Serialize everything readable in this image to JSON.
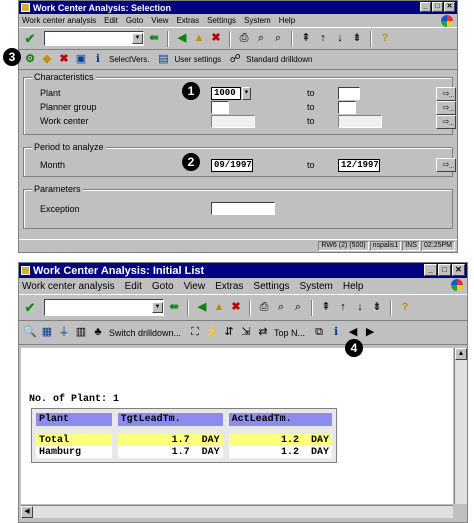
{
  "window1": {
    "title": "Work Center Analysis: Selection",
    "menu": [
      "Work center analysis",
      "Edit",
      "Goto",
      "View",
      "Extras",
      "Settings",
      "System",
      "Help"
    ],
    "app_toolbar": {
      "selectvers_label": "SelectVers.",
      "user_settings_label": "User settings",
      "standard_drilldown_label": "Standard drilldown"
    },
    "characteristics": {
      "title": "Characteristics",
      "plant_label": "Plant",
      "plant_value": "1000",
      "planner_group_label": "Planner group",
      "work_center_label": "Work center",
      "to_label": "to"
    },
    "period": {
      "title": "Period to analyze",
      "month_label": "Month",
      "from_value": "09/1997",
      "to_label": "to",
      "to_value": "12/1997"
    },
    "parameters": {
      "title": "Parameters",
      "exception_label": "Exception"
    },
    "status": {
      "system": "RW6 (2) (500)",
      "server": "nspalis1",
      "mode": "INS",
      "time": "02:25PM"
    }
  },
  "window2": {
    "title": "Work Center Analysis: Initial List",
    "menu": [
      "Work center analysis",
      "Edit",
      "Goto",
      "View",
      "Extras",
      "Settings",
      "System",
      "Help"
    ],
    "app_toolbar": {
      "switch_drilldown_label": "Switch drilldown...",
      "top_n_label": "Top N..."
    },
    "report": {
      "title": "No. of Plant: 1",
      "headers": [
        "Plant",
        "TgtLeadTm.",
        "ActLeadTm."
      ],
      "rows": [
        {
          "plant": "Total",
          "tgt_value": "1.7",
          "tgt_unit": "DAY",
          "act_value": "1.2",
          "act_unit": "DAY",
          "highlight": true
        },
        {
          "plant": "Hamburg",
          "tgt_value": "1.7",
          "tgt_unit": "DAY",
          "act_value": "1.2",
          "act_unit": "DAY",
          "highlight": false
        }
      ]
    }
  },
  "callouts": [
    "1",
    "2",
    "3",
    "4"
  ],
  "colors": {
    "title_bar": "#000080",
    "window_face": "#c0c0c0",
    "table_header": "#8c8cf0",
    "total_row": "#ffff80"
  }
}
